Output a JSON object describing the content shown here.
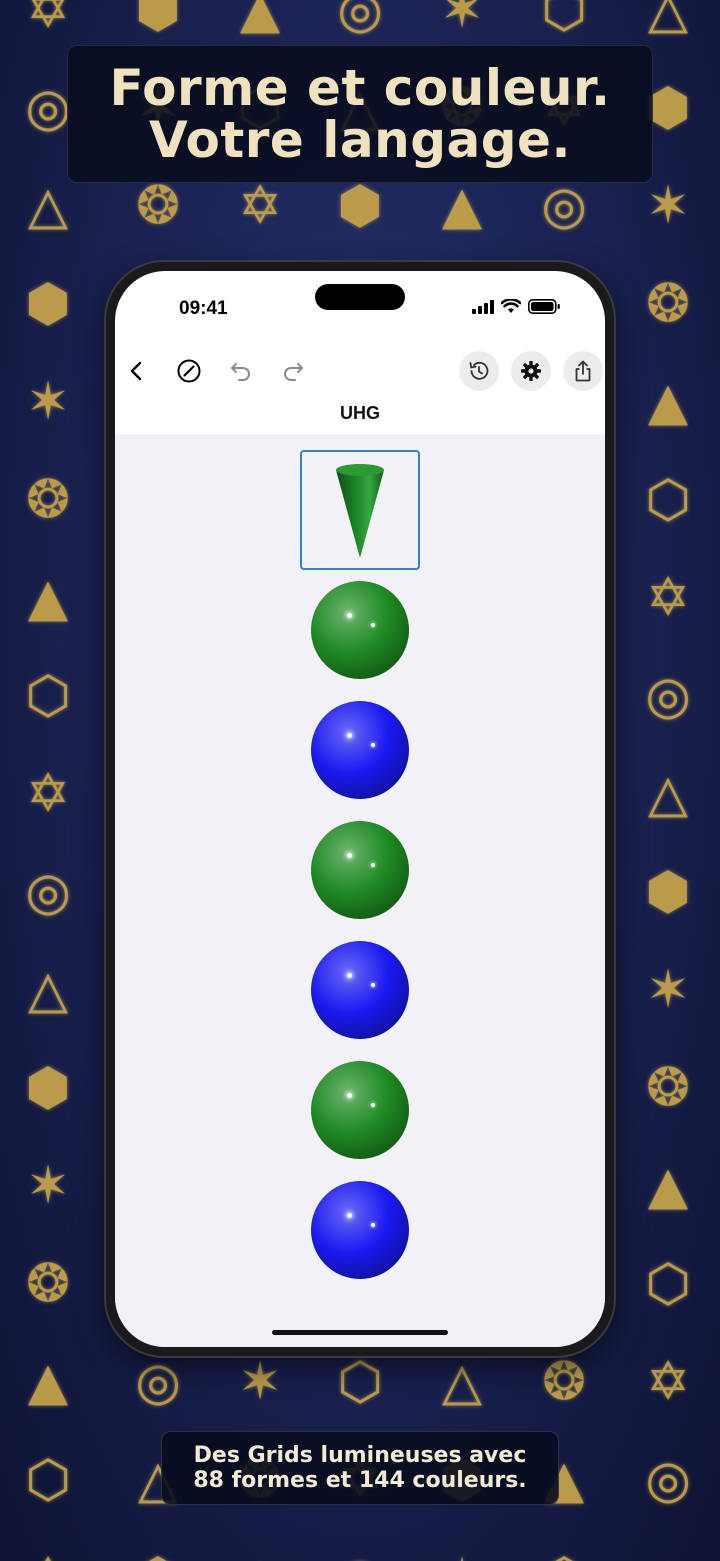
{
  "marketing": {
    "headline_line1": "Forme et couleur.",
    "headline_line2": "Votre langage.",
    "caption_line1": "Des Grids lumineuses avec",
    "caption_line2": "88 formes et 144 couleurs."
  },
  "status_bar": {
    "time": "09:41",
    "icons": [
      "cellular-signal-icon",
      "wifi-icon",
      "battery-icon"
    ]
  },
  "toolbar": {
    "left_icons": [
      "back-chevron-icon",
      "clear-icon",
      "undo-icon",
      "redo-icon"
    ],
    "right_icons": [
      "history-icon",
      "settings-gear-icon",
      "share-icon"
    ]
  },
  "document": {
    "title": "UHG"
  },
  "grid": {
    "shapes": [
      {
        "type": "cone",
        "color": "#1f8a2a",
        "selected": true
      },
      {
        "type": "sphere",
        "color": "#1e8a22",
        "selected": false
      },
      {
        "type": "sphere",
        "color": "#1a1af0",
        "selected": false
      },
      {
        "type": "sphere",
        "color": "#1e8a22",
        "selected": false
      },
      {
        "type": "sphere",
        "color": "#1a1af0",
        "selected": false
      },
      {
        "type": "sphere",
        "color": "#1e8a22",
        "selected": false
      },
      {
        "type": "sphere",
        "color": "#1a1af0",
        "selected": false
      }
    ],
    "selection_color": "#2f80d9"
  },
  "colors": {
    "headline_text": "#f1e2bf",
    "background": "#1b2455",
    "pattern_gold": "#c9a64a"
  }
}
